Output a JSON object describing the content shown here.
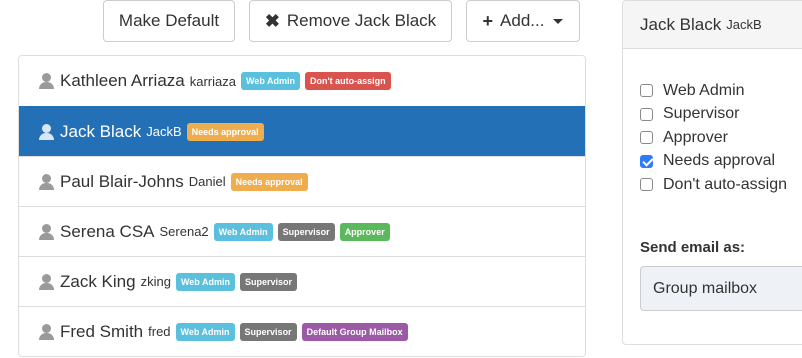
{
  "toolbar": {
    "make_default_label": "Make Default",
    "remove_label": "Remove Jack Black",
    "remove_icon": "✖",
    "add_label": "Add...",
    "add_icon": "+"
  },
  "colors": {
    "selected_row": "#2470b7",
    "badge_web_admin": "#5bc0de",
    "badge_dont_auto_assign": "#d9534f",
    "badge_needs_approval": "#f0ad4e",
    "badge_supervisor": "#777777",
    "badge_approver": "#5cb85c",
    "badge_default_group_mailbox": "#9b59a6",
    "checkbox_checked": "#2e7cf6"
  },
  "users": [
    {
      "name": "Kathleen Arriaza",
      "login": "karriaza",
      "selected": false,
      "badges": [
        {
          "label": "Web Admin",
          "color": "#5bc0de"
        },
        {
          "label": "Don't auto-assign",
          "color": "#d9534f"
        }
      ]
    },
    {
      "name": "Jack Black",
      "login": "JackB",
      "selected": true,
      "badges": [
        {
          "label": "Needs approval",
          "color": "#f0ad4e"
        }
      ]
    },
    {
      "name": "Paul Blair-Johns",
      "login": "Daniel",
      "selected": false,
      "badges": [
        {
          "label": "Needs approval",
          "color": "#f0ad4e"
        }
      ]
    },
    {
      "name": "Serena CSA",
      "login": "Serena2",
      "selected": false,
      "badges": [
        {
          "label": "Web Admin",
          "color": "#5bc0de"
        },
        {
          "label": "Supervisor",
          "color": "#777777"
        },
        {
          "label": "Approver",
          "color": "#5cb85c"
        }
      ]
    },
    {
      "name": "Zack King",
      "login": "zking",
      "selected": false,
      "badges": [
        {
          "label": "Web Admin",
          "color": "#5bc0de"
        },
        {
          "label": "Supervisor",
          "color": "#777777"
        }
      ]
    },
    {
      "name": "Fred Smith",
      "login": "fred",
      "selected": false,
      "badges": [
        {
          "label": "Web Admin",
          "color": "#5bc0de"
        },
        {
          "label": "Supervisor",
          "color": "#777777"
        },
        {
          "label": "Default Group Mailbox",
          "color": "#9b59a6"
        }
      ]
    }
  ],
  "detail": {
    "title": "Jack Black",
    "login": "JackB",
    "roles": [
      {
        "label": "Web Admin",
        "checked": false
      },
      {
        "label": "Supervisor",
        "checked": false
      },
      {
        "label": "Approver",
        "checked": false
      },
      {
        "label": "Needs approval",
        "checked": true
      },
      {
        "label": "Don't auto-assign",
        "checked": false
      }
    ],
    "send_email_label": "Send email as:",
    "send_email_value": "Group mailbox"
  }
}
